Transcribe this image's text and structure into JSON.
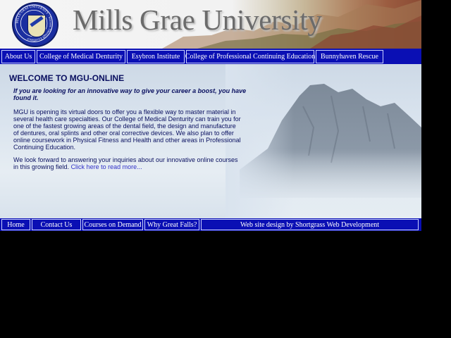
{
  "banner": {
    "title": "Mills Grae University",
    "logo_ring_text": "MILLS GRAE UNIVERSITY · Success Through Excellence"
  },
  "top_nav": [
    {
      "label": "About Us"
    },
    {
      "label": "College of Medical Denturity"
    },
    {
      "label": "Esybron Institute"
    },
    {
      "label": "College of Professional Continuing Education"
    },
    {
      "label": "Bunnyhaven Rescue"
    }
  ],
  "main": {
    "heading": "WELCOME TO MGU-ONLINE",
    "lead": "If you are looking for an innovative way to give your career a boost, you have found it.",
    "paragraph1": "MGU is opening its virtual doors to offer you a flexible way to master material in several health care specialties. Our College of Medical Denturity can train you for one of the fastest growing areas of the dental field, the design and manufacture of dentures, oral splints and other oral corrective devices. We also plan to offer online coursework in Physical Fitness and Health and other areas in Professional Continuing Education.",
    "paragraph2": "We look forward to answering your inquiries about our innovative online courses in this growing field.",
    "read_more": "Click here to read more..."
  },
  "bottom_nav": [
    {
      "label": "Home"
    },
    {
      "label": "Contact Us"
    },
    {
      "label": "Courses on Demand"
    },
    {
      "label": "Why Great Falls?"
    },
    {
      "label": "Web site design by Shortgrass Web Development"
    }
  ],
  "colors": {
    "nav_blue": "#0a0fb4",
    "heading_text": "#0a1060",
    "link": "#3232c8"
  }
}
